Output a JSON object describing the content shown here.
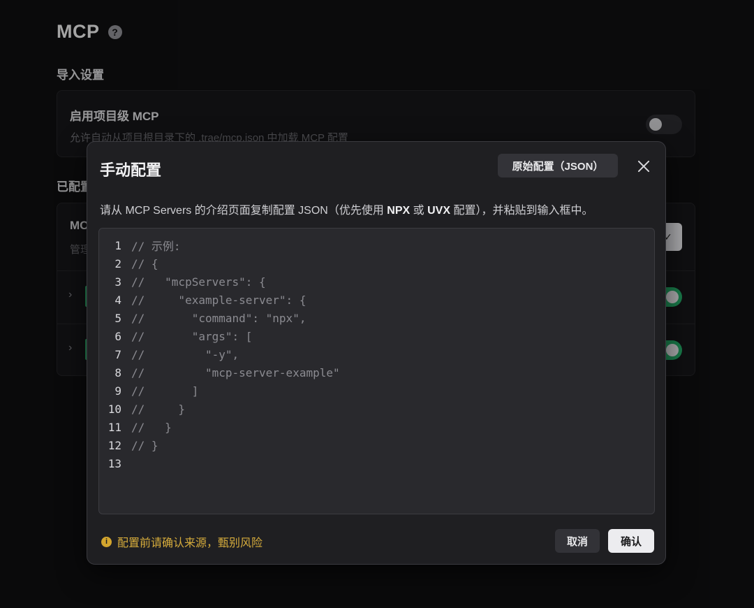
{
  "page": {
    "title": "MCP",
    "help_icon": "?",
    "import_section": "导入设置",
    "project_mcp": {
      "title": "启用项目级 MCP",
      "description": "允许自动从项目根目录下的 .trae/mcp.json 中加载 MCP 配置",
      "enabled": false
    },
    "configured_section": "已配置",
    "configured_card": {
      "title": "MC",
      "description": "管理",
      "check_icon": "✓"
    },
    "server_rows": [
      {
        "chevron": "›",
        "enabled": true
      },
      {
        "chevron": "›",
        "enabled": true
      }
    ]
  },
  "modal": {
    "title": "手动配置",
    "raw_config_label": "原始配置（JSON）",
    "description_parts": [
      {
        "text": "请从 MCP Servers 的介绍页面复制配置 JSON（优先使用 ",
        "bold": false
      },
      {
        "text": "NPX",
        "bold": true
      },
      {
        "text": " 或 ",
        "bold": false
      },
      {
        "text": "UVX",
        "bold": true
      },
      {
        "text": " 配置），并粘贴到输入框中。",
        "bold": false
      }
    ],
    "code_lines": [
      {
        "num": "1",
        "text": "// 示例:"
      },
      {
        "num": "2",
        "text": "// {"
      },
      {
        "num": "3",
        "text": "//   \"mcpServers\": {"
      },
      {
        "num": "4",
        "text": "//     \"example-server\": {"
      },
      {
        "num": "5",
        "text": "//       \"command\": \"npx\","
      },
      {
        "num": "6",
        "text": "//       \"args\": ["
      },
      {
        "num": "7",
        "text": "//         \"-y\","
      },
      {
        "num": "8",
        "text": "//         \"mcp-server-example\""
      },
      {
        "num": "9",
        "text": "//       ]"
      },
      {
        "num": "10",
        "text": "//     }"
      },
      {
        "num": "11",
        "text": "//   }"
      },
      {
        "num": "12",
        "text": "// }"
      },
      {
        "num": "13",
        "text": ""
      }
    ],
    "warning_icon": "i",
    "warning": "配置前请确认来源，甄别风险",
    "cancel_label": "取消",
    "confirm_label": "确认"
  },
  "colors": {
    "accent_green": "#23a866",
    "warning_yellow": "#d6ac3c",
    "modal_bg": "#1f1f22",
    "editor_bg": "#29292d"
  }
}
